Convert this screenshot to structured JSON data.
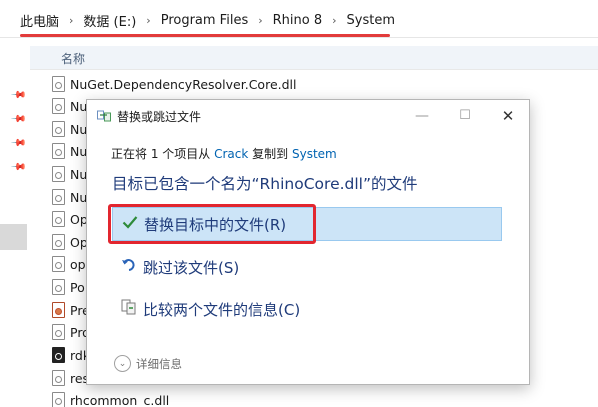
{
  "breadcrumb": {
    "items": [
      "此电脑",
      "数据 (E:)",
      "Program Files",
      "Rhino 8",
      "System"
    ],
    "separator": "›"
  },
  "filelist": {
    "column_name": "名称",
    "rows": [
      {
        "name": "NuGet.DependencyResolver.Core.dll",
        "icon": "dll-file-icon"
      },
      {
        "name": "Nu",
        "icon": "dll-file-icon"
      },
      {
        "name": "Nu",
        "icon": "dll-file-icon"
      },
      {
        "name": "Nu",
        "icon": "dll-file-icon"
      },
      {
        "name": "Nu",
        "icon": "dll-file-icon"
      },
      {
        "name": "Nu",
        "icon": "dll-file-icon"
      },
      {
        "name": "Op",
        "icon": "dll-file-icon"
      },
      {
        "name": "Op",
        "icon": "dll-file-icon"
      },
      {
        "name": "op",
        "icon": "dll-file-icon"
      },
      {
        "name": "Po",
        "icon": "dll-file-icon"
      },
      {
        "name": "Pre",
        "icon": "rhino-file-icon"
      },
      {
        "name": "Pro",
        "icon": "dll-file-icon"
      },
      {
        "name": "rdk",
        "icon": "app-file-icon"
      },
      {
        "name": "res",
        "icon": "dll-file-icon"
      },
      {
        "name": "rhcommon_c.dll",
        "icon": "dll-file-icon"
      }
    ]
  },
  "dialog": {
    "title": "替换或跳过文件",
    "from_prefix": "正在将 1 个项目从",
    "from_source": "Crack",
    "from_mid": "复制到",
    "from_dest": "System",
    "heading": "目标已包含一个名为“RhinoCore.dll”的文件",
    "options": [
      {
        "label": "替换目标中的文件(R)",
        "icon": "checkmark-icon",
        "selected": true
      },
      {
        "label": "跳过该文件(S)",
        "icon": "skip-arrow-icon",
        "selected": false
      },
      {
        "label": "比较两个文件的信息(C)",
        "icon": "compare-files-icon",
        "selected": false
      }
    ],
    "details_label": "详细信息"
  },
  "colors": {
    "accent_link": "#0063b1",
    "heading_blue": "#1f3b7a",
    "selected_bg": "#cce4f7",
    "highlight_red": "#e2262f"
  }
}
